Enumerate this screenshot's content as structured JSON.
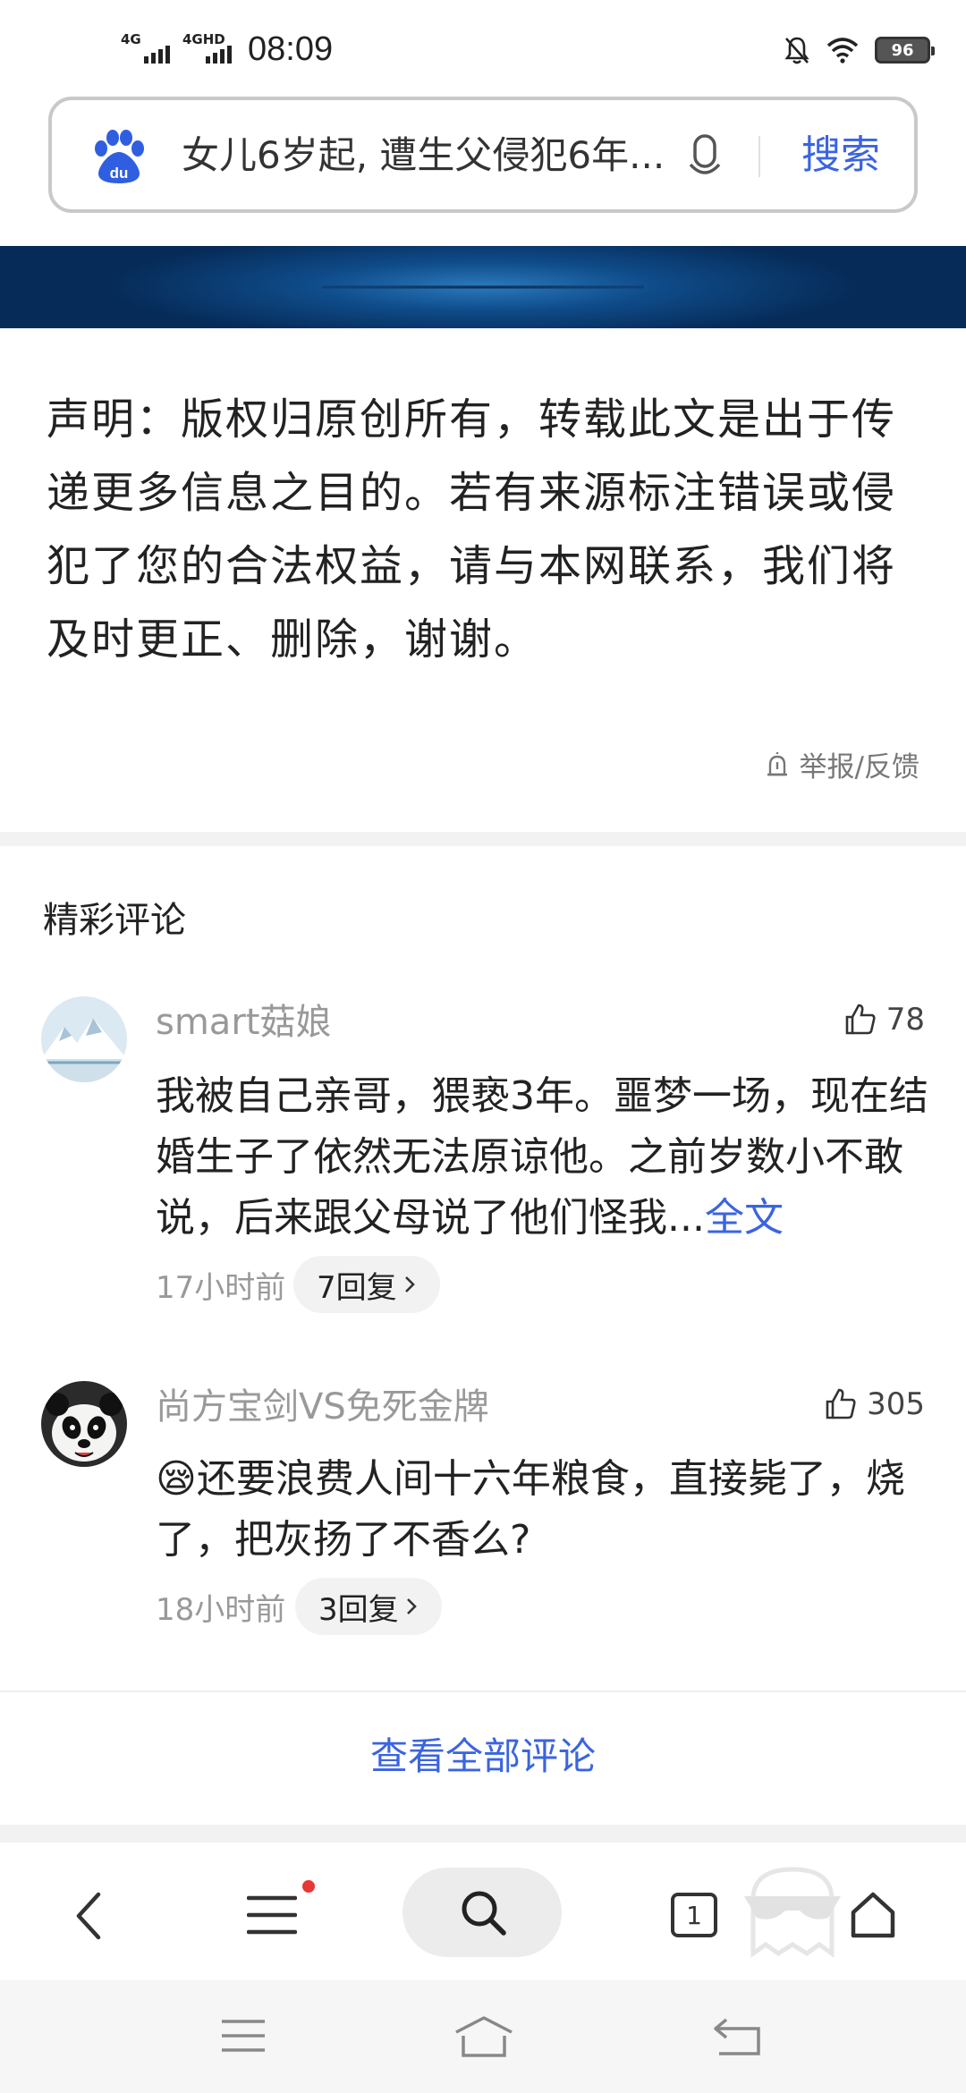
{
  "status_bar": {
    "net1": "4G",
    "net2": "4GHD",
    "time": "08:09",
    "battery": "96"
  },
  "search": {
    "query": "女儿6岁起, 遭生父侵犯6年...",
    "button_label": "搜索"
  },
  "article": {
    "statement": "声明：版权归原创所有，转载此文是出于传递更多信息之目的。若有来源标注错误或侵犯了您的合法权益，请与本网联系，我们将及时更正、删除，谢谢。",
    "report_label": "举报/反馈"
  },
  "comments": {
    "section_title": "精彩评论",
    "items": [
      {
        "author": "smart菇娘",
        "likes": "78",
        "text": "我被自己亲哥，猥亵3年。噩梦一场，现在结婚生子了依然无法原谅他。之前岁数小不敢说，后来跟父母说了他们怪我...",
        "more_label": "全文",
        "time": "17小时前",
        "replies": "7回复"
      },
      {
        "author": "尚方宝剑VS免死金牌",
        "likes": "305",
        "emoji": "😪",
        "text": "还要浪费人间十六年粮食，直接毙了，烧了，把灰扬了不香么?",
        "time": "18小时前",
        "replies": "3回复"
      }
    ],
    "view_all_label": "查看全部评论"
  },
  "toolbar": {
    "tabs_count": "1"
  },
  "colors": {
    "accent": "#3a64e0",
    "banner": "#0f4c8a",
    "badge_red": "#e53935"
  }
}
